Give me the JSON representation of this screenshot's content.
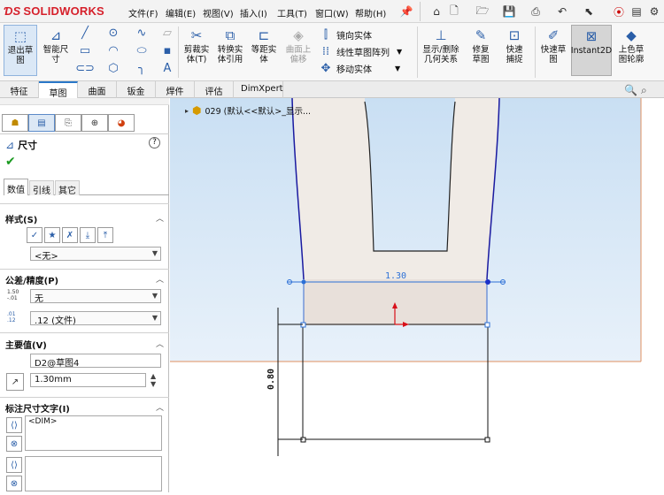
{
  "app": {
    "brand": "SOLIDWORKS",
    "brand_color": "#d6202b"
  },
  "menu": [
    "文件(F)",
    "编辑(E)",
    "视图(V)",
    "插入(I)",
    "工具(T)",
    "窗口(W)",
    "帮助(H)"
  ],
  "ribbon": {
    "exit_sketch": "退出草图",
    "smart_dim": "智能尺寸",
    "trim": "剪裁实体(T)",
    "convert": "转换实体引用",
    "offset": "等距实体",
    "surface_offset": "曲面上偏移",
    "mirror": "镜向实体",
    "linear_pattern": "线性草图阵列",
    "move": "移动实体",
    "show_relations": "显示/删除几何关系",
    "repair": "修复草图",
    "quick_snap": "快速捕捉",
    "rapid_sketch": "快速草图",
    "instant2d": "Instant2D",
    "shaded_contours": "上色草图轮廓"
  },
  "tabs": [
    "特征",
    "草图",
    "曲面",
    "钣金",
    "焊件",
    "评估",
    "DimXpert"
  ],
  "active_tab": 1,
  "pm": {
    "title": "尺寸",
    "help": "?",
    "subtabs": [
      "数值",
      "引线",
      "其它"
    ],
    "style_head": "样式(S)",
    "style_value": "<无>",
    "tol_head": "公差/精度(P)",
    "tol_value": "无",
    "precision_value": ".12 (文件)",
    "primary_head": "主要值(V)",
    "primary_name": "D2@草图4",
    "primary_value": "1.30mm",
    "dimtext_head": "标注尺寸文字(I)",
    "dimtext_value": "<DIM>",
    "tol_icon_text": "1.50\n-.01",
    "prec_icon_text": ".01\n.12"
  },
  "tree": {
    "item": "029 (默认<<默认>_显示..."
  },
  "dims": {
    "horizontal": "1.30",
    "vertical": "0.80"
  },
  "colors": {
    "dim_blue": "#2b6fd6",
    "dim_black": "#111111",
    "profile_fill": "#f0ebe6",
    "profile_edge": "#1a1aa0",
    "sketch_red": "#d8101a"
  }
}
